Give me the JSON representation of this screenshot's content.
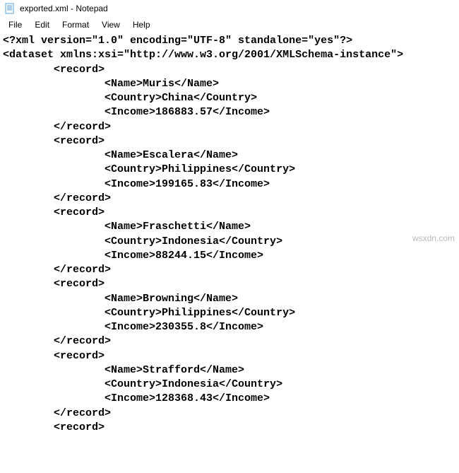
{
  "titlebar": {
    "icon": "notepad-icon",
    "title": "exported.xml - Notepad"
  },
  "menubar": {
    "items": [
      "File",
      "Edit",
      "Format",
      "View",
      "Help"
    ]
  },
  "content": {
    "lines": [
      "<?xml version=\"1.0\" encoding=\"UTF-8\" standalone=\"yes\"?>",
      "<dataset xmlns:xsi=\"http://www.w3.org/2001/XMLSchema-instance\">",
      "        <record>",
      "                <Name>Muris</Name>",
      "                <Country>China</Country>",
      "                <Income>186883.57</Income>",
      "        </record>",
      "        <record>",
      "                <Name>Escalera</Name>",
      "                <Country>Philippines</Country>",
      "                <Income>199165.83</Income>",
      "        </record>",
      "        <record>",
      "                <Name>Fraschetti</Name>",
      "                <Country>Indonesia</Country>",
      "                <Income>88244.15</Income>",
      "        </record>",
      "        <record>",
      "                <Name>Browning</Name>",
      "                <Country>Philippines</Country>",
      "                <Income>230355.8</Income>",
      "        </record>",
      "        <record>",
      "                <Name>Strafford</Name>",
      "                <Country>Indonesia</Country>",
      "                <Income>128368.43</Income>",
      "        </record>",
      "        <record>"
    ]
  },
  "watermark": "wsxdn.com"
}
